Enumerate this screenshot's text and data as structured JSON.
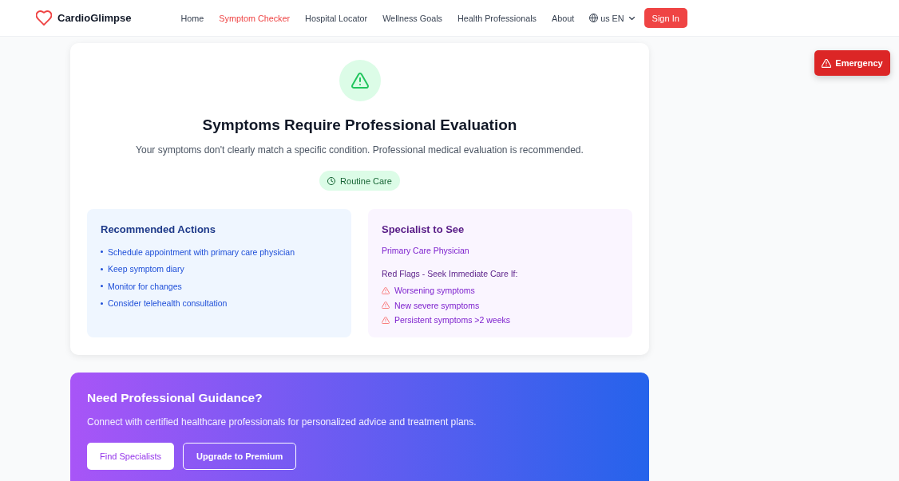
{
  "header": {
    "logo": "CardioGlimpse",
    "nav": [
      {
        "label": "Home",
        "selected": false
      },
      {
        "label": "Symptom Checker",
        "selected": true
      },
      {
        "label": "Hospital Locator",
        "selected": false
      },
      {
        "label": "Wellness Goals",
        "selected": false
      },
      {
        "label": "Health Professionals",
        "selected": false
      },
      {
        "label": "About",
        "selected": false
      }
    ],
    "language": "us EN",
    "sign_in": "Sign In"
  },
  "emergency_button": "Emergency",
  "result": {
    "title": "Symptoms Require Professional Evaluation",
    "description": "Your symptoms don't clearly match a specific condition. Professional medical evaluation is recommended.",
    "urgency": {
      "label": "Routine Care",
      "kind": "routine"
    },
    "recommended_actions": {
      "title": "Recommended Actions",
      "items": [
        "Schedule appointment with primary care physician",
        "Keep symptom diary",
        "Monitor for changes",
        "Consider telehealth consultation"
      ]
    },
    "specialist": {
      "title": "Specialist to See",
      "name": "Primary Care Physician",
      "red_flags_title": "Red Flags - Seek Immediate Care If:",
      "red_flags": [
        "Worsening symptoms",
        "New severe symptoms",
        "Persistent symptoms >2 weeks"
      ]
    }
  },
  "guidance_banner": {
    "title": "Need Professional Guidance?",
    "text": "Connect with certified healthcare professionals for personalized advice and treatment plans.",
    "buttons": [
      {
        "label": "Find Specialists",
        "kind": "solid"
      },
      {
        "label": "Upgrade to Premium",
        "kind": "outline"
      }
    ]
  }
}
